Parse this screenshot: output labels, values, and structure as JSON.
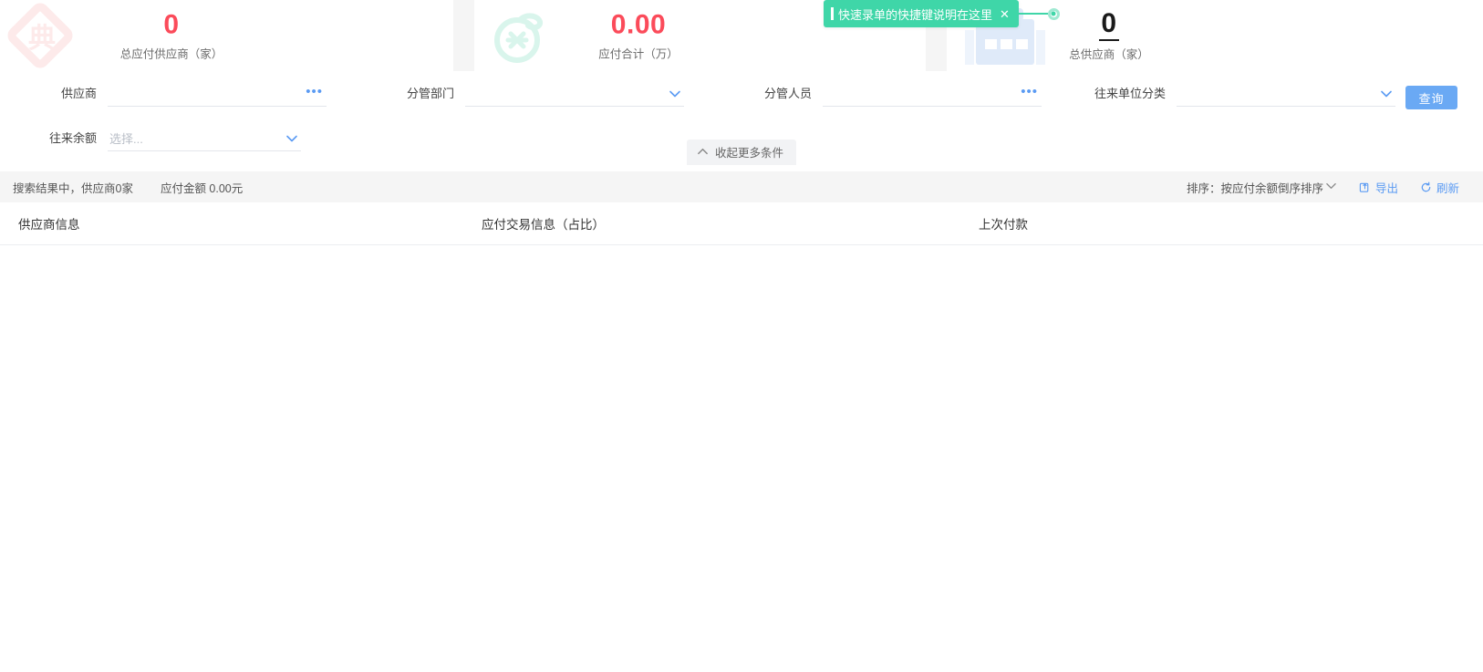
{
  "stats": {
    "cards": [
      {
        "value": "0",
        "label": "总应付供应商（家）",
        "icon": "diamond-watermark-icon",
        "value_color": "#fb4b5a"
      },
      {
        "value": "0.00",
        "label": "应付合计（万）",
        "icon": "coin-watermark-icon",
        "value_color": "#fb4b5a"
      },
      {
        "value": "0",
        "label": "总供应商（家）",
        "icon": "building-watermark-icon",
        "value_color": "#1a1a1a"
      }
    ]
  },
  "tooltip": {
    "text": "快速录单的快捷键说明在这里",
    "close_label": "✕",
    "color": "#3fd6a8"
  },
  "filters": {
    "supplier": {
      "label": "供应商",
      "value": "",
      "placeholder": "",
      "more_label": "•••"
    },
    "department": {
      "label": "分管部门",
      "value": "",
      "placeholder": ""
    },
    "person": {
      "label": "分管人员",
      "value": "",
      "placeholder": "",
      "more_label": "•••"
    },
    "category": {
      "label": "往来单位分类",
      "value": "",
      "placeholder": ""
    },
    "balance": {
      "label": "往来余额",
      "value": "",
      "placeholder": "选择..."
    },
    "query_button": "查询",
    "collapse_label": "收起更多条件"
  },
  "result_bar": {
    "summary": "搜索结果中，供应商0家",
    "amount": "应付金额 0.00元",
    "sort_label": "排序：按应付余额倒序排序",
    "export_label": "导出",
    "refresh_label": "刷新"
  },
  "table": {
    "columns": [
      "供应商信息",
      "应付交易信息（占比）",
      "上次付款"
    ],
    "rows": []
  }
}
